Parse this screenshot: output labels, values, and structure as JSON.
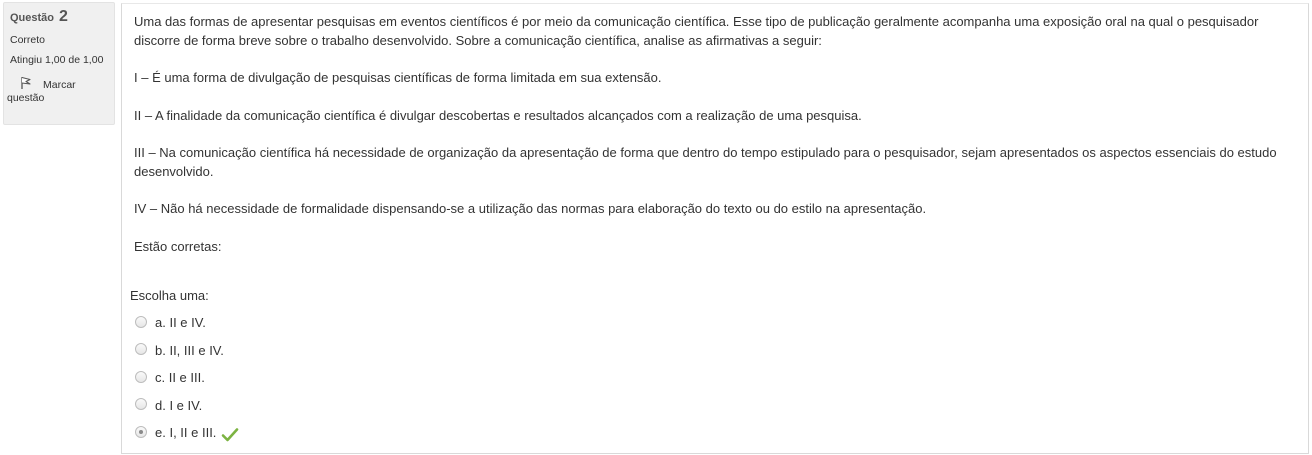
{
  "info": {
    "question_label": "Questão",
    "question_number": "2",
    "state": "Correto",
    "grade": "Atingiu 1,00 de 1,00",
    "flag_line1": "Marcar",
    "flag_line2": "questão",
    "flag_icon": "flag-icon"
  },
  "question": {
    "intro": "Uma das formas de apresentar pesquisas em eventos científicos é por meio da comunicação científica. Esse tipo de publicação geralmente acompanha uma exposição oral na qual o pesquisador discorre de forma breve sobre o trabalho desenvolvido. Sobre a comunicação científica, analise as afirmativas a seguir:",
    "statements": [
      "I – É uma forma de divulgação de pesquisas científicas de forma limitada em sua extensão.",
      "II – A finalidade da comunicação científica é divulgar descobertas e resultados alcançados com a realização de uma pesquisa.",
      "III – Na comunicação científica há necessidade de organização da apresentação de forma que dentro do tempo estipulado para o pesquisador, sejam apresentados os aspectos essenciais do estudo desenvolvido.",
      "IV – Não há necessidade de formalidade dispensando-se a utilização das normas para elaboração do texto ou do estilo na apresentação."
    ],
    "ask": "Estão corretas:",
    "prompt": "Escolha uma:"
  },
  "answers": [
    {
      "label": "a. II e IV.",
      "checked": false
    },
    {
      "label": "b. II, III e IV.",
      "checked": false
    },
    {
      "label": "c. II e III.",
      "checked": false
    },
    {
      "label": "d. I e IV.",
      "checked": false
    },
    {
      "label": "e. I, II e III.",
      "checked": true,
      "correct_icon": "check-icon"
    }
  ],
  "colors": {
    "correct": "#7cb342",
    "info_bg": "#f0f0f0"
  }
}
